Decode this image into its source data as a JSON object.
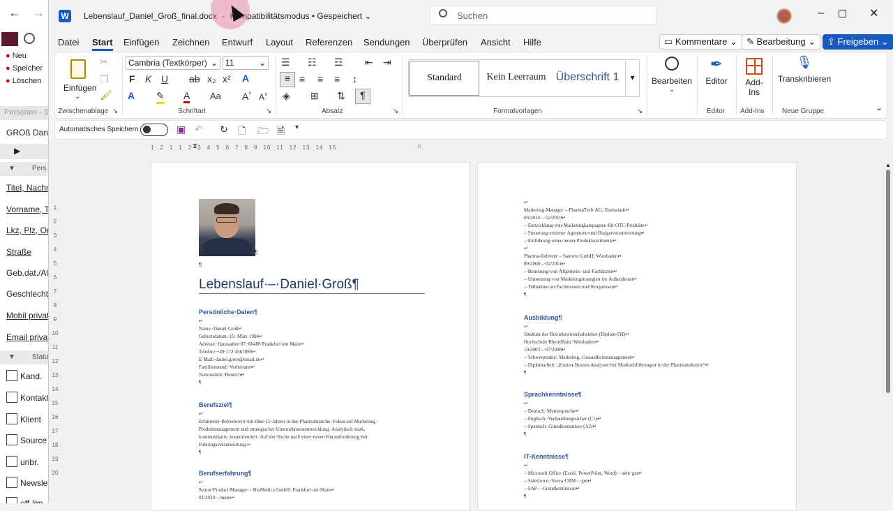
{
  "bg_app": {
    "menu": [
      "Neu",
      "Speicher",
      "Löschen"
    ],
    "tab_label": "Personen - S",
    "record_title": "GROß Danie",
    "section1": "Pers",
    "fields": [
      "Titel, Nachn",
      "Vorname, Ti",
      "Lkz, Plz, Ort",
      "Straße",
      "Geb.dat./Alt",
      "Geschlecht",
      "Mobil privat",
      "Email privat"
    ],
    "section2": "Statu",
    "status": [
      "Kand.",
      "Kontakt",
      "Klient",
      "Source",
      "unbr.",
      "Newslet",
      "off-lim"
    ]
  },
  "titlebar": {
    "filename": "Lebenslauf_Daniel_Groß_final.docx",
    "dash": "-",
    "mode": "Kompatibilitätsmodus • Gespeichert",
    "search_placeholder": "Suchen"
  },
  "menu": [
    "Datei",
    "Start",
    "Einfügen",
    "Zeichnen",
    "Entwurf",
    "Layout",
    "Referenzen",
    "Sendungen",
    "Überprüfen",
    "Ansicht",
    "Hilfe"
  ],
  "actions": {
    "comments": "Kommentare",
    "editing": "Bearbeitung",
    "share": "Freigeben"
  },
  "ribbon": {
    "paste": "Einfügen",
    "clipboard": "Zwischenablage",
    "font_name": "Cambria (Textkörper)",
    "font_size": "11",
    "font": "Schriftart",
    "paragraph": "Absatz",
    "styles": [
      "Standard",
      "Kein Leerraum",
      "Überschrift 1"
    ],
    "styles_label": "Formatvorlagen",
    "edit": "Bearbeiten",
    "editor": "Editor",
    "editor_group": "Editor",
    "addins": "Add-Ins",
    "addins_group": "Add-Ins",
    "transcribe": "Transkribieren",
    "new_group": "Neue Gruppe"
  },
  "qat": {
    "autosave": "Automatisches Speichern"
  },
  "ruler": [
    "1",
    "2",
    "1",
    "1",
    "2",
    "3",
    "4",
    "5",
    "6",
    "7",
    "8",
    "9",
    "10",
    "11",
    "12",
    "13",
    "14",
    "15"
  ],
  "vruler": [
    "1",
    "2",
    "3",
    "4",
    "5",
    "6",
    "7",
    "8",
    "9",
    "10",
    "11",
    "12",
    "13",
    "14",
    "15",
    "16",
    "17",
    "18",
    "19",
    "20"
  ],
  "page1": {
    "pilcrow": "¶",
    "title": "Lebenslauf·–·Daniel·Groß¶",
    "h_personal": "Persönliche·Daten¶",
    "personal": [
      "↵",
      "Name:·Daniel·Groß↵",
      "Geburtsdatum:·19.·März·1984↵",
      "Adresse:·Hansaallee·87,·60486·Frankfurt·am·Main↵",
      "Telefon:·+49·172·4567890↵",
      "E-Mail:·daniel.gross@email.de↵",
      "Familienstand:·Verheiratet↵",
      "Nationalität:·Deutsch↵",
      "¶"
    ],
    "h_goal": "Berufsziel¶",
    "goal": [
      "↵",
      "Erfahrener·Betriebswirt·mit·über·15·Jahren·in·der·Pharmabranche.·Fokus·auf·Marketing,·",
      "Produktmanagement·und·strategischer·Unternehmensentwicklung.·Analytisch·stark,·",
      "kommunikativ,·teamorientiert.·Auf·der·Suche·nach·einer·neuen·Herausforderung·mit·",
      "Führungsverantwortung.↵",
      "¶"
    ],
    "h_exp": "Berufserfahrung¶",
    "exp": [
      "↵",
      "Senior·Product·Manager·–·BioMedica·GmbH,·Frankfurt·am·Main↵",
      "01/2020·–·heute↵"
    ]
  },
  "page2": {
    "exp": [
      "↵",
      "Marketing-Manager·–·PharmaTech·AG,·Darmstadt↵",
      "03/2014·–·12/2019↵",
      "–·Entwicklung·von·Marketingkampagnen·für·OTC-Produkte↵",
      "–·Steuerung·externer·Agenturen·und·Budgetverantwortung↵",
      "–·Einführung·eines·neuen·Produktsortiments↵",
      "↵",
      "Pharma-Referent·–·Sanovis·GmbH,·Wiesbaden↵",
      "09/2008·–·02/2014↵",
      "–·Betreuung·von·Allgemein-·und·Fachärzten↵",
      "–·Umsetzung·von·Marketingstrategien·im·Außendienst↵",
      "–·Teilnahme·an·Fachmessen·und·Kongressen↵",
      "¶"
    ],
    "h_edu": "Ausbildung¶",
    "edu": [
      "↵",
      "Studium·der·Betriebswirtschaftslehre·(Diplom-FH)↵",
      "Hochschule·RheinMain,·Wiesbaden↵",
      "10/2003·–·07/2008↵",
      "–·Schwerpunkte:·Marketing,·Gesundheitsmanagement↵",
      "–·Diplomarbeit:·„Kosten-Nutzen-Analysen·bei·Markteinführungen·in·der·Pharmaindustrie“↵",
      "¶"
    ],
    "h_lang": "Sprachkenntnisse¶",
    "lang": [
      "↵",
      "–·Deutsch:·Muttersprache↵",
      "–·Englisch:·Verhandlungssicher·(C1)↵",
      "–·Spanisch:·Grundkenntnisse·(A2)↵",
      "¶"
    ],
    "h_it": "IT-Kenntnisse¶",
    "it": [
      "↵",
      "–·Microsoft·Office·(Excel,·PowerPoint,·Word)·–·sehr·gut↵",
      "–·Salesforce,·Veeva·CRM·–·gut↵",
      "–·SAP·–·Grundkenntnisse↵",
      "¶"
    ]
  },
  "colors": {
    "accent": "#185abd",
    "heading": "#2e5395",
    "title": "#1f3864"
  }
}
